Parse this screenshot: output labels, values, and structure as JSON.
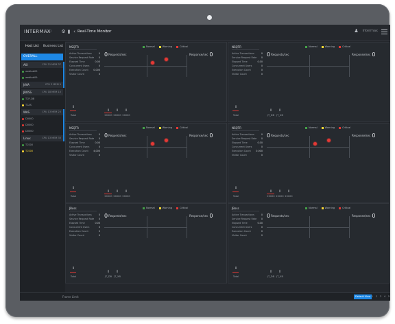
{
  "header": {
    "brand": "INTERMAX",
    "brand_sub": "TRD",
    "title": "Real-Time Monitor",
    "user": "intermax"
  },
  "sidebar": {
    "tabs": [
      "Host List",
      "Business List"
    ],
    "overall": "OVERALL",
    "groups": [
      {
        "name": "AIX",
        "info": "CPU 21 MEM 37",
        "agents": [
          {
            "name": "webtob09",
            "color": "#43a047"
          },
          {
            "name": "webtob09",
            "color": "#43a047"
          }
        ]
      },
      {
        "name": "JAVA",
        "info": "CPU 3 MEM 9",
        "agents": []
      },
      {
        "name": "JBOSS",
        "info": "CPU 18 MEM 10",
        "agents": [
          {
            "name": "TCP_DB",
            "color": "#43a047"
          },
          {
            "name": "TCAS",
            "color": "#fdd835"
          }
        ]
      },
      {
        "name": "WAS",
        "info": "CPU 13 MEM 23",
        "agents": [
          {
            "name": "D0000",
            "color": "#e53935"
          },
          {
            "name": "D0000",
            "color": "#e53935"
          },
          {
            "name": "D0000",
            "color": "#e53935"
          }
        ]
      },
      {
        "name": "Linux",
        "info": "CPU 13 MEM 33",
        "agents": [
          {
            "name": "TCS00",
            "color": "#43a047"
          },
          {
            "name": "TCS00",
            "color": "#fdd835"
          }
        ]
      }
    ]
  },
  "legend": {
    "normal": "Normal",
    "warning": "Warning",
    "critical": "Critical"
  },
  "rt": {
    "left_label": "Requests/sec",
    "right_label": "Response/sec",
    "left_value": "0",
    "right_value": "0"
  },
  "stat_labels": [
    "Active Transactions",
    "Service Request Rate",
    "Elapsed Time",
    "Concurrent Users",
    "Execution Count",
    "Visitor Count"
  ],
  "panels": [
    {
      "title": "NSQTR",
      "stats": [
        "0",
        "0",
        "0.00",
        "0",
        "0.000",
        "0"
      ],
      "bars": [
        {
          "n": "0",
          "l": "20000"
        },
        {
          "n": "0",
          "l": "20000"
        },
        {
          "n": "0",
          "l": "20000"
        }
      ],
      "bubbles": true
    },
    {
      "title": "NSQTR",
      "stats": [
        "0",
        "0",
        "0.00",
        "0",
        "0",
        "0"
      ],
      "bars": [
        {
          "n": "0",
          "l": "JT_DB"
        },
        {
          "n": "0",
          "l": "JT_XB"
        }
      ],
      "bubbles": false
    },
    {
      "title": "NSQTR",
      "stats": [
        "0",
        "0",
        "0.00",
        "0",
        "4,000",
        "0"
      ],
      "bars": [
        {
          "n": "0",
          "l": "20000"
        },
        {
          "n": "0",
          "l": "20000"
        },
        {
          "n": "0",
          "l": "20000"
        }
      ],
      "bubbles": true
    },
    {
      "title": "NSQTR",
      "stats": [
        "0",
        "0",
        "0.00",
        "0",
        "0.000",
        "0"
      ],
      "bars": [
        {
          "n": "0",
          "l": "20000"
        },
        {
          "n": "0",
          "l": "20000"
        },
        {
          "n": "0",
          "l": "20000"
        }
      ],
      "bubbles": true
    },
    {
      "title": "JBoss",
      "stats": [
        "0",
        "0",
        "0.00",
        "0",
        "0",
        "0"
      ],
      "bars": [
        {
          "n": "0",
          "l": "JT_DB"
        },
        {
          "n": "0",
          "l": "JT_XB"
        }
      ],
      "bubbles": false
    },
    {
      "title": "JBoss",
      "stats": [
        "0",
        "0",
        "0.00",
        "0",
        "0",
        "0"
      ],
      "bars": [
        {
          "n": "0",
          "l": "JT_DB"
        },
        {
          "n": "0",
          "l": "JT_XB"
        }
      ],
      "bubbles": false
    }
  ],
  "bar_total": {
    "n": "0",
    "l": "Total"
  },
  "footer": {
    "left": "Frame Limit",
    "button": "Default View",
    "pages": [
      "1",
      "2",
      "3",
      "4",
      "5"
    ]
  },
  "colors": {
    "accent": "#1e88e5",
    "critical": "#e53935",
    "warning": "#fdd835",
    "normal": "#43a047"
  }
}
